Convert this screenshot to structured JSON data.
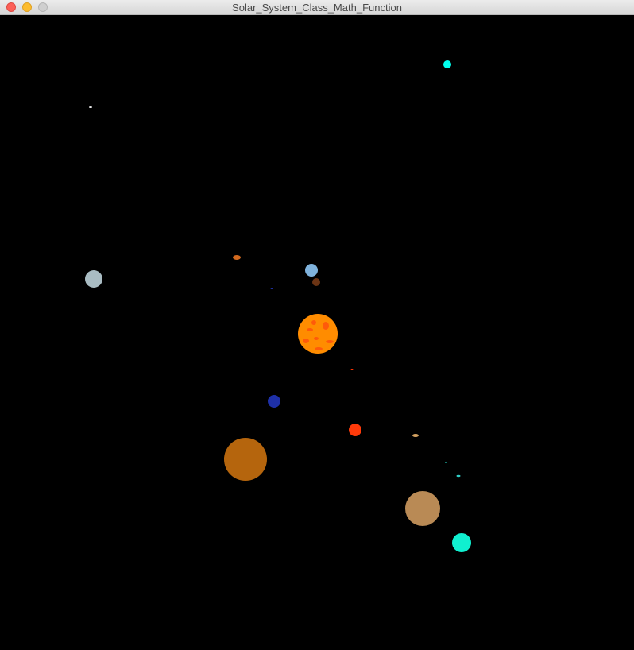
{
  "window": {
    "title": "Solar_System_Class_Math_Function",
    "buttons": {
      "close": "close",
      "minimize": "minimize",
      "zoom": "zoom"
    }
  },
  "scene": {
    "background": "#000000",
    "sun": {
      "color": "#ff8c00",
      "spot_color": "#ff5a0a"
    },
    "bodies": [
      {
        "name": "planet-cyan-small",
        "color": "#00ffee"
      },
      {
        "name": "dust-white",
        "color": "#e8e8e8"
      },
      {
        "name": "planet-pale-gray",
        "color": "#a9bcc3"
      },
      {
        "name": "moon-orange",
        "color": "#d2691e"
      },
      {
        "name": "planet-light-blue",
        "color": "#7fb2dc"
      },
      {
        "name": "moon-brown",
        "color": "#6b3414"
      },
      {
        "name": "dust-navy",
        "color": "#1e2fa0"
      },
      {
        "name": "dust-red",
        "color": "#ff3300"
      },
      {
        "name": "planet-navy",
        "color": "#1e30a8"
      },
      {
        "name": "planet-red-orange",
        "color": "#ff3a0a"
      },
      {
        "name": "moon-tan",
        "color": "#d2a060"
      },
      {
        "name": "planet-jupiter",
        "color": "#b5650d"
      },
      {
        "name": "dust-teal",
        "color": "#20c0b0"
      },
      {
        "name": "moon-teal",
        "color": "#30d0c8"
      },
      {
        "name": "planet-tan",
        "color": "#b98a55"
      },
      {
        "name": "planet-aqua",
        "color": "#10f0d0"
      }
    ]
  }
}
